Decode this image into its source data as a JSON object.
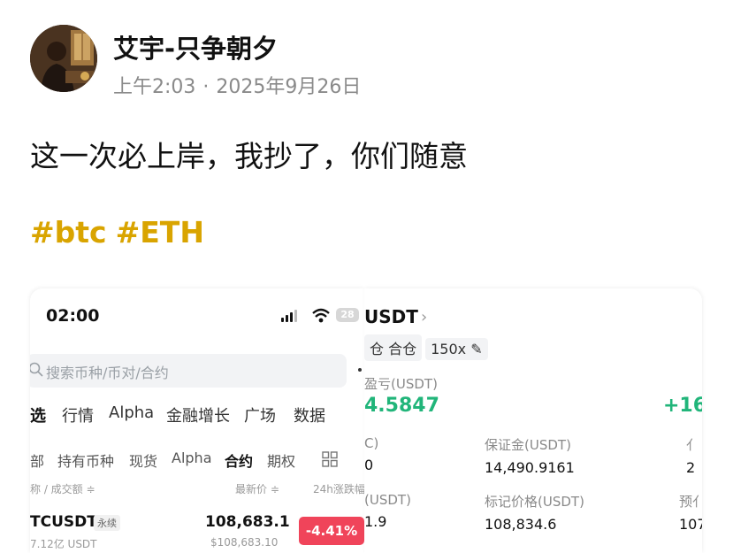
{
  "post": {
    "author": "艾宇-只争朝夕",
    "time": "上午2:03",
    "separator": "·",
    "date": "2025年9月26日",
    "text": "这一次必上岸，我抄了，你们随意",
    "tags": [
      "#btc",
      "#ETH"
    ],
    "accent_color": "#d9a400"
  },
  "left_screenshot": {
    "status_time": "02:00",
    "battery": "28",
    "search_placeholder": "搜索币种/币对/合约",
    "tabs_primary": [
      "选",
      "行情",
      "Alpha",
      "金融增长",
      "广场",
      "数据"
    ],
    "tabs_secondary": [
      "部",
      "持有币种",
      "现货",
      "Alpha",
      "合约",
      "期权"
    ],
    "tabs_secondary_active": "合约",
    "columns": {
      "name": "称 / 成交额 ≑",
      "price": "最新价 ≑",
      "change": "24h涨跌幅"
    },
    "row": {
      "symbol": "TCUSDT",
      "badge": "永续",
      "volume": "7.12亿 USDT",
      "price": "108,683.1",
      "fiat_price": "$108,683.10",
      "change": "-4.41%",
      "change_color": "#f0445a"
    }
  },
  "right_screenshot": {
    "title": "USDT",
    "pills": [
      "仓 合仓",
      "150x ✎"
    ],
    "pnl_label": "盈亏(USDT)",
    "pnl_value": "4.5847",
    "pnl_percent": "+16",
    "pnl_color": "#21b57a",
    "row1": [
      {
        "label": "C)",
        "value": "0"
      },
      {
        "label": "保证金(USDT)",
        "value": "14,490.9161"
      },
      {
        "label": "亻",
        "value": "2"
      }
    ],
    "row2": [
      {
        "label": "(USDT)",
        "value": "1.9"
      },
      {
        "label": "标记价格(USDT)",
        "value": "108,834.6"
      },
      {
        "label": "预亻",
        "value": "107"
      }
    ]
  }
}
